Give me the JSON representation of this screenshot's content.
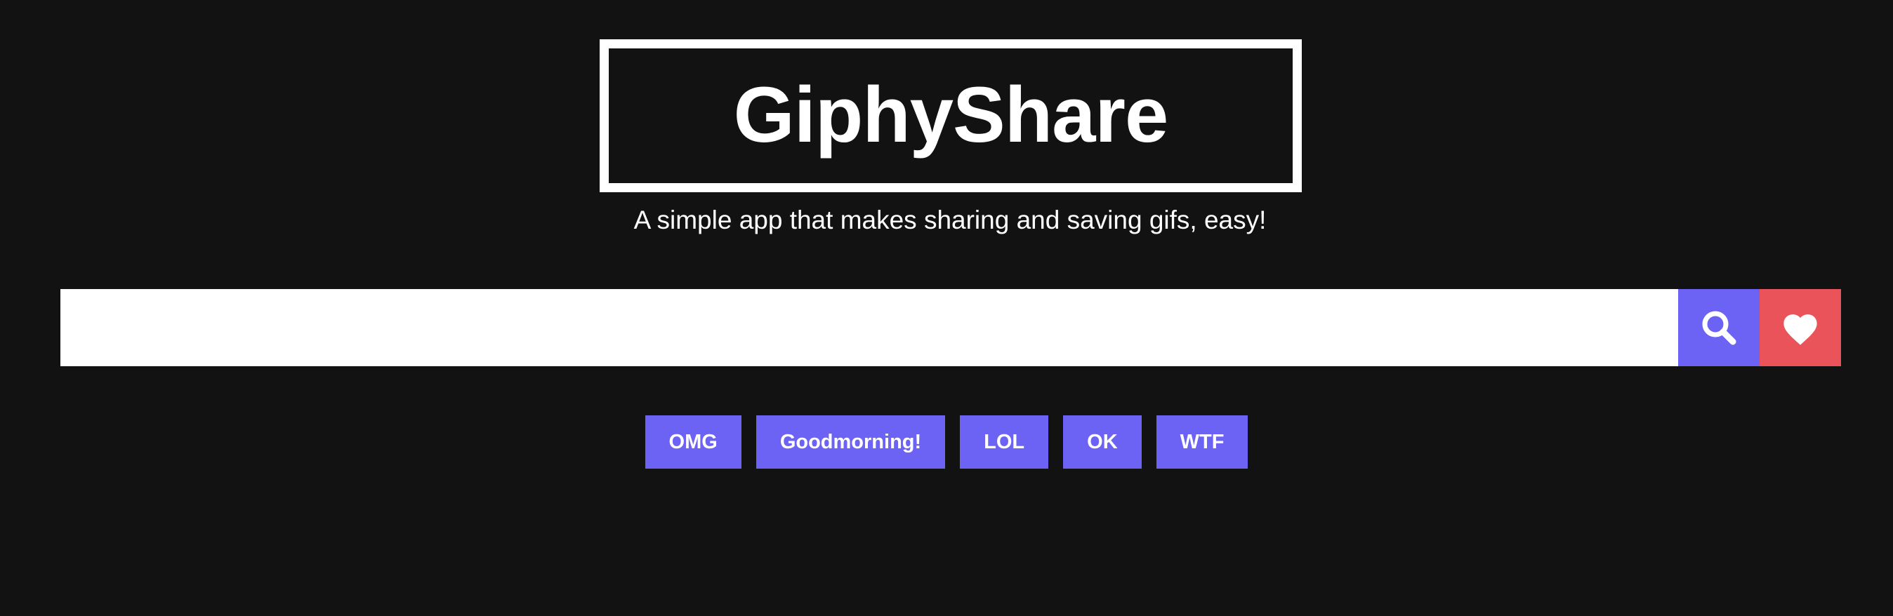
{
  "header": {
    "logo": "GiphyShare",
    "tagline": "A simple app that makes sharing and saving gifs, easy!"
  },
  "search": {
    "value": "",
    "placeholder": "",
    "search_icon": "magnifying-glass",
    "favorites_icon": "heart",
    "search_button_color": "#6c63f5",
    "favorites_button_color": "#ea5359"
  },
  "tags": [
    {
      "label": "OMG"
    },
    {
      "label": "Goodmorning!"
    },
    {
      "label": "LOL"
    },
    {
      "label": "OK"
    },
    {
      "label": "WTF"
    }
  ],
  "colors": {
    "background": "#121212",
    "accent": "#6c63f5",
    "favorite": "#ea5359"
  }
}
